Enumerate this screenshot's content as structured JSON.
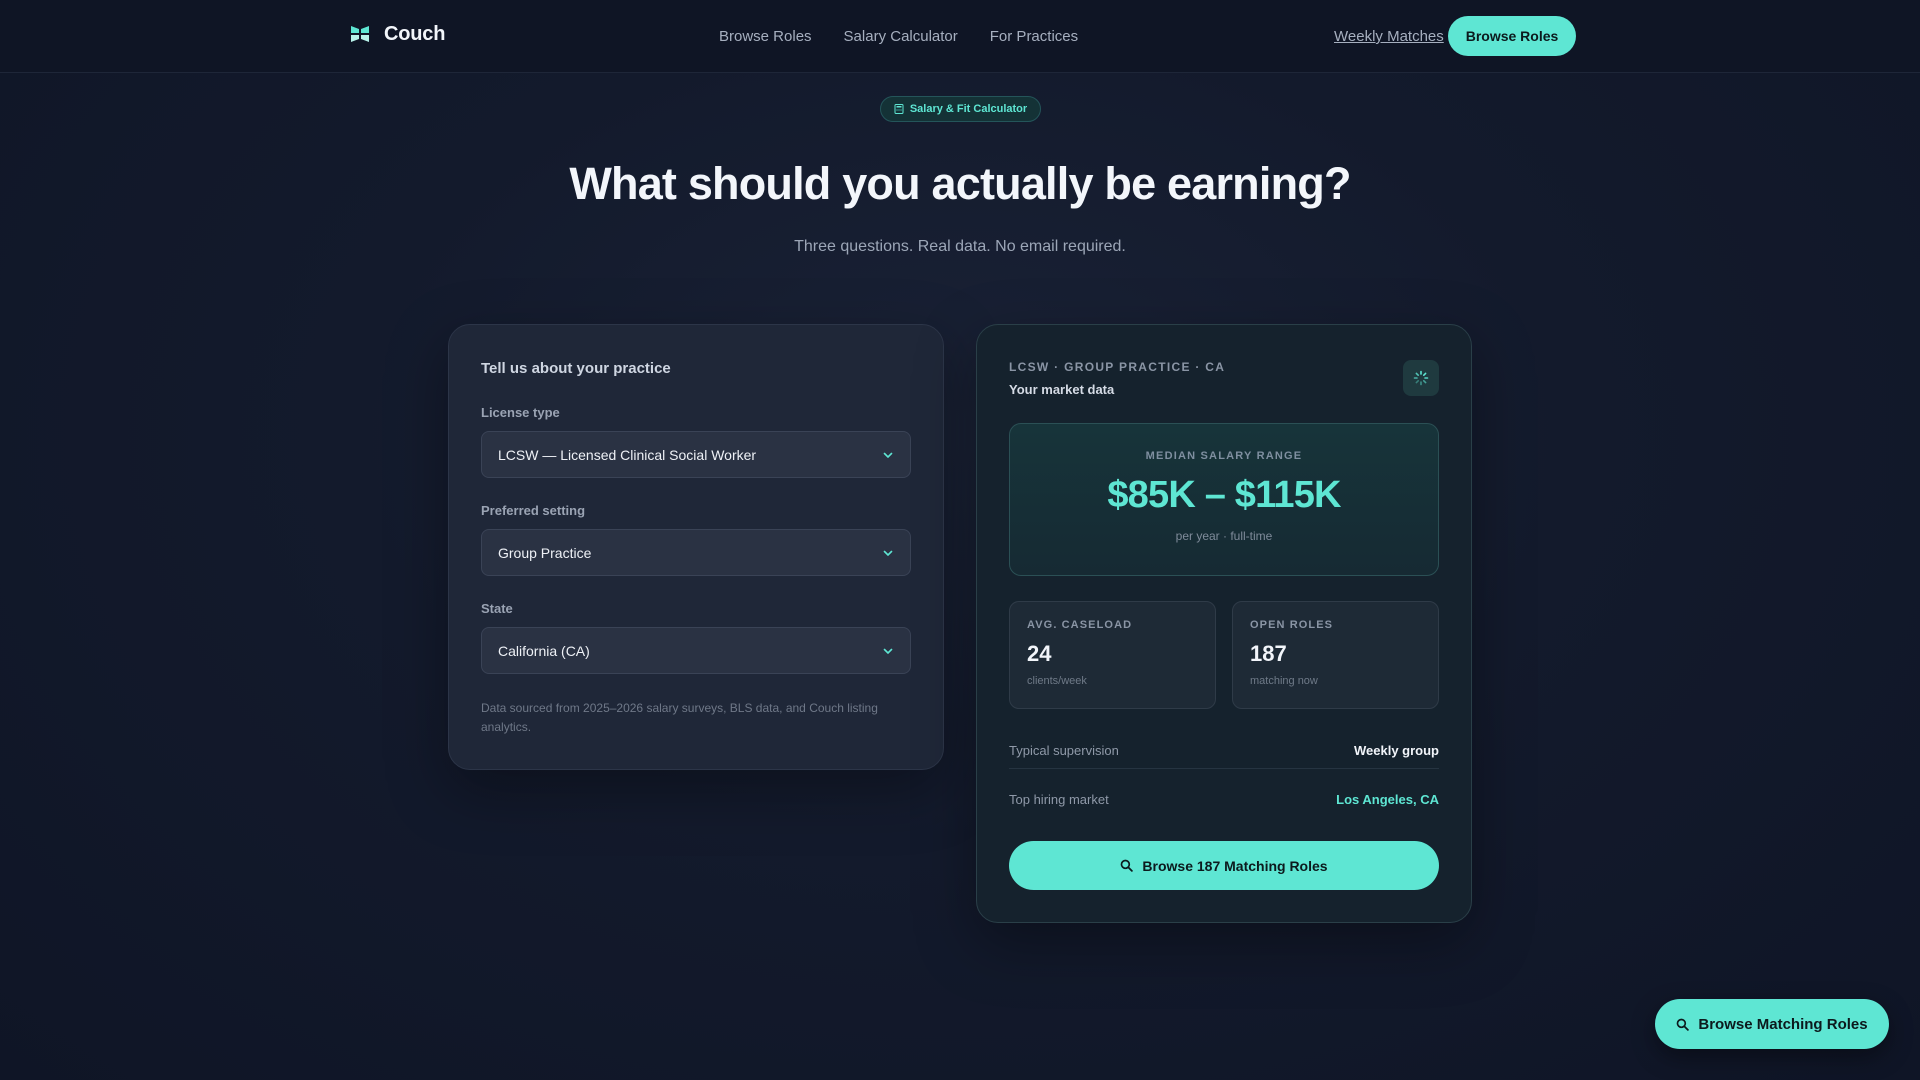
{
  "header": {
    "brand": "Couch",
    "nav": [
      "Browse Roles",
      "Salary Calculator",
      "For Practices"
    ],
    "weekly_matches": "Weekly Matches",
    "browse_button": "Browse Roles"
  },
  "hero": {
    "badge": "Salary & Fit Calculator",
    "title": "What should you actually be earning?",
    "subtitle": "Three questions. Real data. No email required."
  },
  "form": {
    "heading": "Tell us about your practice",
    "license_label": "License type",
    "license_value": "LCSW — Licensed Clinical Social Worker",
    "setting_label": "Preferred setting",
    "setting_value": "Group Practice",
    "state_label": "State",
    "state_value": "California (CA)",
    "source_note": "Data sourced from 2025–2026 salary surveys, BLS data, and Couch listing analytics."
  },
  "results": {
    "eyebrow": "LCSW · GROUP PRACTICE · CA",
    "title": "Your market data",
    "salary_label": "MEDIAN SALARY RANGE",
    "salary_value": "$85K – $115K",
    "salary_note": "per year · full-time",
    "caseload_label": "AVG. CASELOAD",
    "caseload_value": "24",
    "caseload_note": "clients/week",
    "roles_label": "OPEN ROLES",
    "roles_value": "187",
    "roles_note": "matching now",
    "supervision_label": "Typical supervision",
    "supervision_value": "Weekly group",
    "market_label": "Top hiring market",
    "market_value": "Los Angeles, CA",
    "cta": "Browse 187 Matching Roles"
  },
  "floating_cta": "Browse Matching Roles",
  "colors": {
    "accent": "#5ee6d3",
    "background": "#111729"
  }
}
